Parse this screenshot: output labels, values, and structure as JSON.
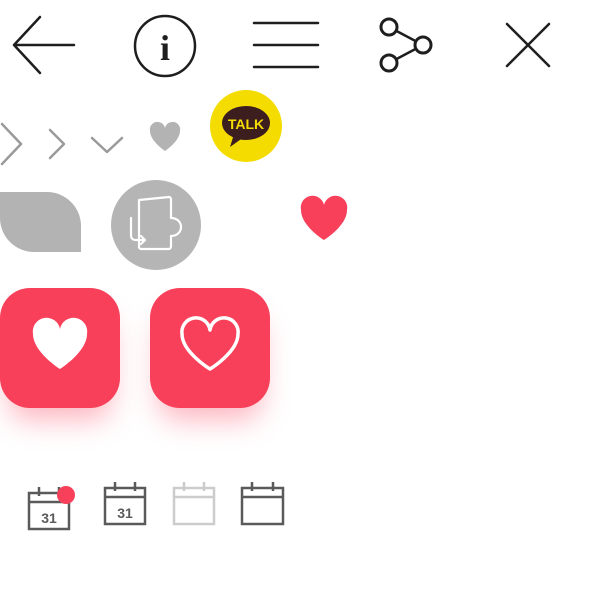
{
  "toolbar": {
    "icons": [
      "back-arrow-icon",
      "info-icon",
      "menu-icon",
      "share-icon",
      "close-icon"
    ],
    "info_glyph": "i"
  },
  "kakao": {
    "icon": "kakaotalk-icon",
    "label": "TALK",
    "badge_color": "#f5dc00",
    "bubble_color": "#3c1e1e",
    "label_color": "#f5dc00"
  },
  "colors": {
    "accent_red": "#f8405a",
    "neutral_gray": "#b3b3b3",
    "line_dark": "#1e1e1e",
    "calendar_dark": "#5a5a5a",
    "calendar_light": "#cccccc"
  },
  "calendars": [
    {
      "icon": "calendar-notification-icon",
      "day": "31"
    },
    {
      "icon": "calendar-icon",
      "day": "31"
    },
    {
      "icon": "calendar-disabled-icon"
    },
    {
      "icon": "calendar-empty-icon"
    }
  ]
}
